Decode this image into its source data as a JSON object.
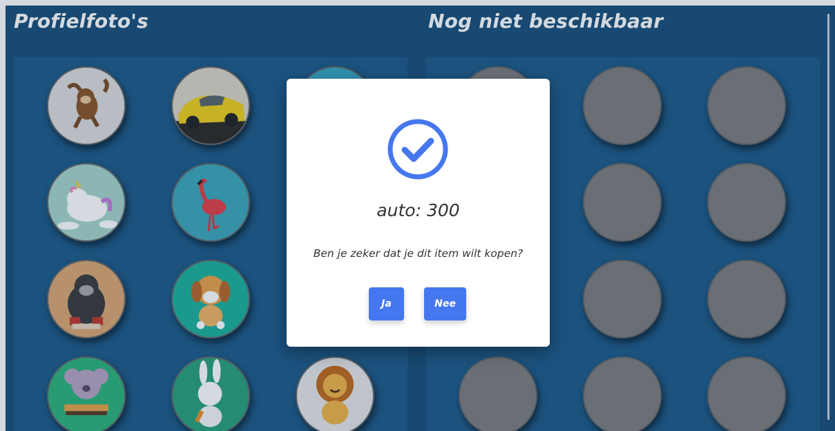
{
  "headings": {
    "owned": "Profielfoto's",
    "unavailable": "Nog niet beschikbaar"
  },
  "owned_avatars": [
    {
      "icon": "monkey-icon",
      "bg": "#d9d9d9"
    },
    {
      "icon": "yellow-car-icon",
      "bg": "#3f3a33"
    },
    {
      "icon": "teal-avatar-icon",
      "bg": "#35a9c2"
    },
    {
      "icon": "unicorn-cat-icon",
      "bg": "#8ec5b7"
    },
    {
      "icon": "flamingo-icon",
      "bg": "#3fa5b6"
    },
    {
      "icon": "gorilla-icon",
      "bg": "#d9a36f"
    },
    {
      "icon": "puppy-icon",
      "bg": "#1fb09a"
    },
    {
      "icon": "koala-burger-icon",
      "bg": "#2fb27a"
    },
    {
      "icon": "bunny-carrot-icon",
      "bg": "#2a9f78"
    },
    {
      "icon": "lion-icon",
      "bg": "#e6e6e6"
    }
  ],
  "locked_avatar_count": 12,
  "modal": {
    "icon": "check-circle-icon",
    "accent": "#4577ef",
    "title": "auto: 300",
    "question": "Ben je zeker dat je dit item wilt kopen?",
    "yes_label": "Ja",
    "no_label": "Nee"
  }
}
